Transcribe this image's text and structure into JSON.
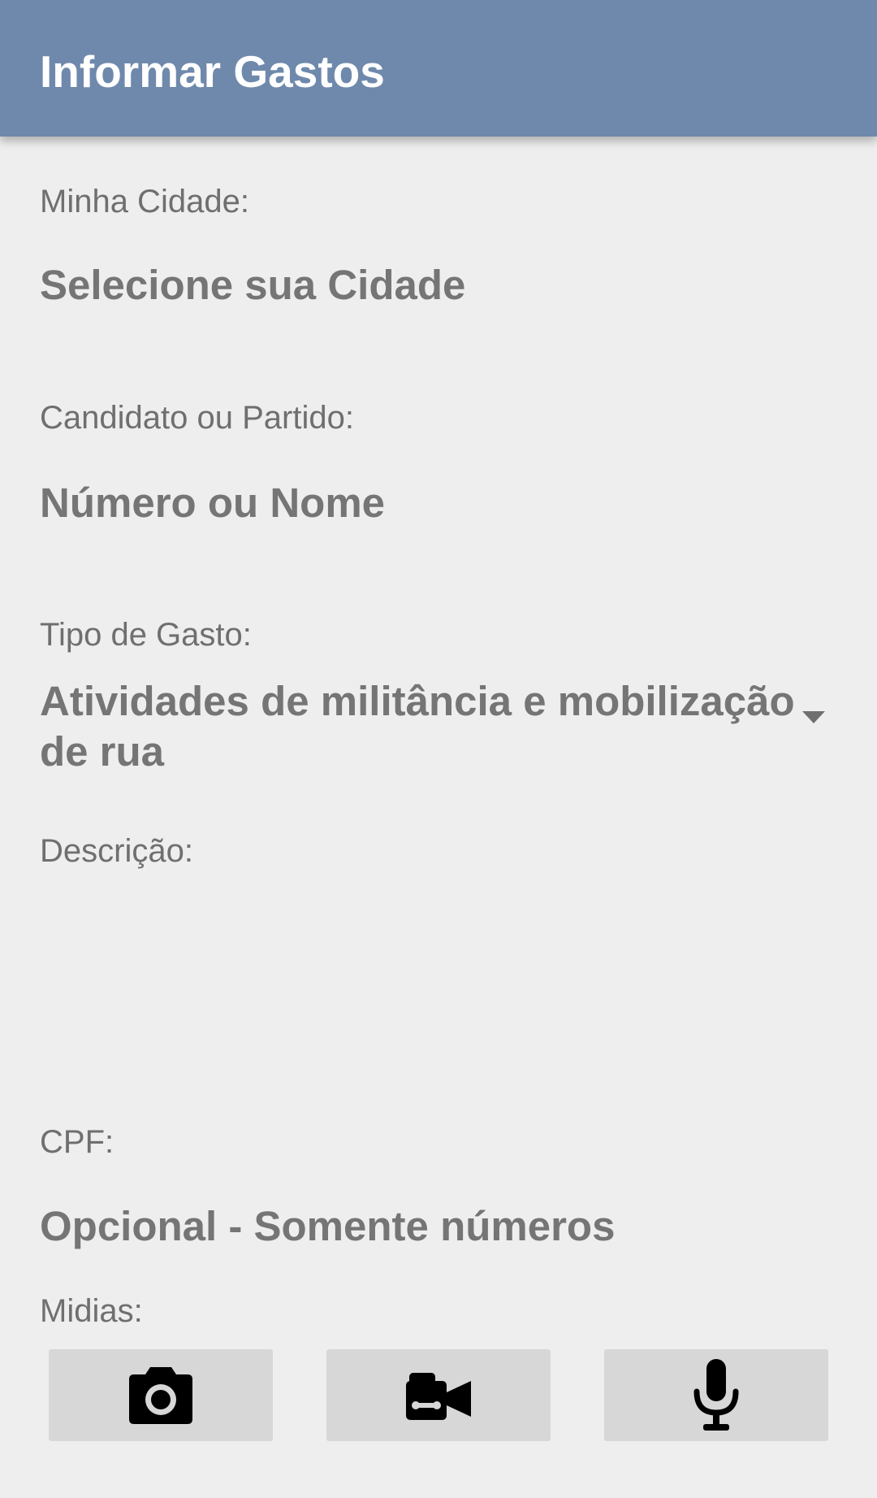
{
  "appbar": {
    "title": "Informar Gastos"
  },
  "form": {
    "city": {
      "label": "Minha Cidade:",
      "placeholder": "Selecione sua Cidade"
    },
    "candidate": {
      "label": "Candidato ou Partido:",
      "placeholder": "Número ou Nome"
    },
    "expense_type": {
      "label": "Tipo de Gasto:",
      "selected": "Atividades de militância e mobilização de rua"
    },
    "description": {
      "label": "Descrição:",
      "value": ""
    },
    "cpf": {
      "label": "CPF:",
      "placeholder": "Opcional - Somente números"
    },
    "media": {
      "label": "Midias:",
      "buttons": [
        {
          "icon": "camera-icon"
        },
        {
          "icon": "videocam-icon"
        },
        {
          "icon": "mic-icon"
        }
      ]
    }
  },
  "colors": {
    "appbar": "#6f89ac",
    "background": "#eeeeee",
    "label_text": "#6f6f6f",
    "hint_text": "#757575",
    "media_button": "#d7d7d7"
  }
}
